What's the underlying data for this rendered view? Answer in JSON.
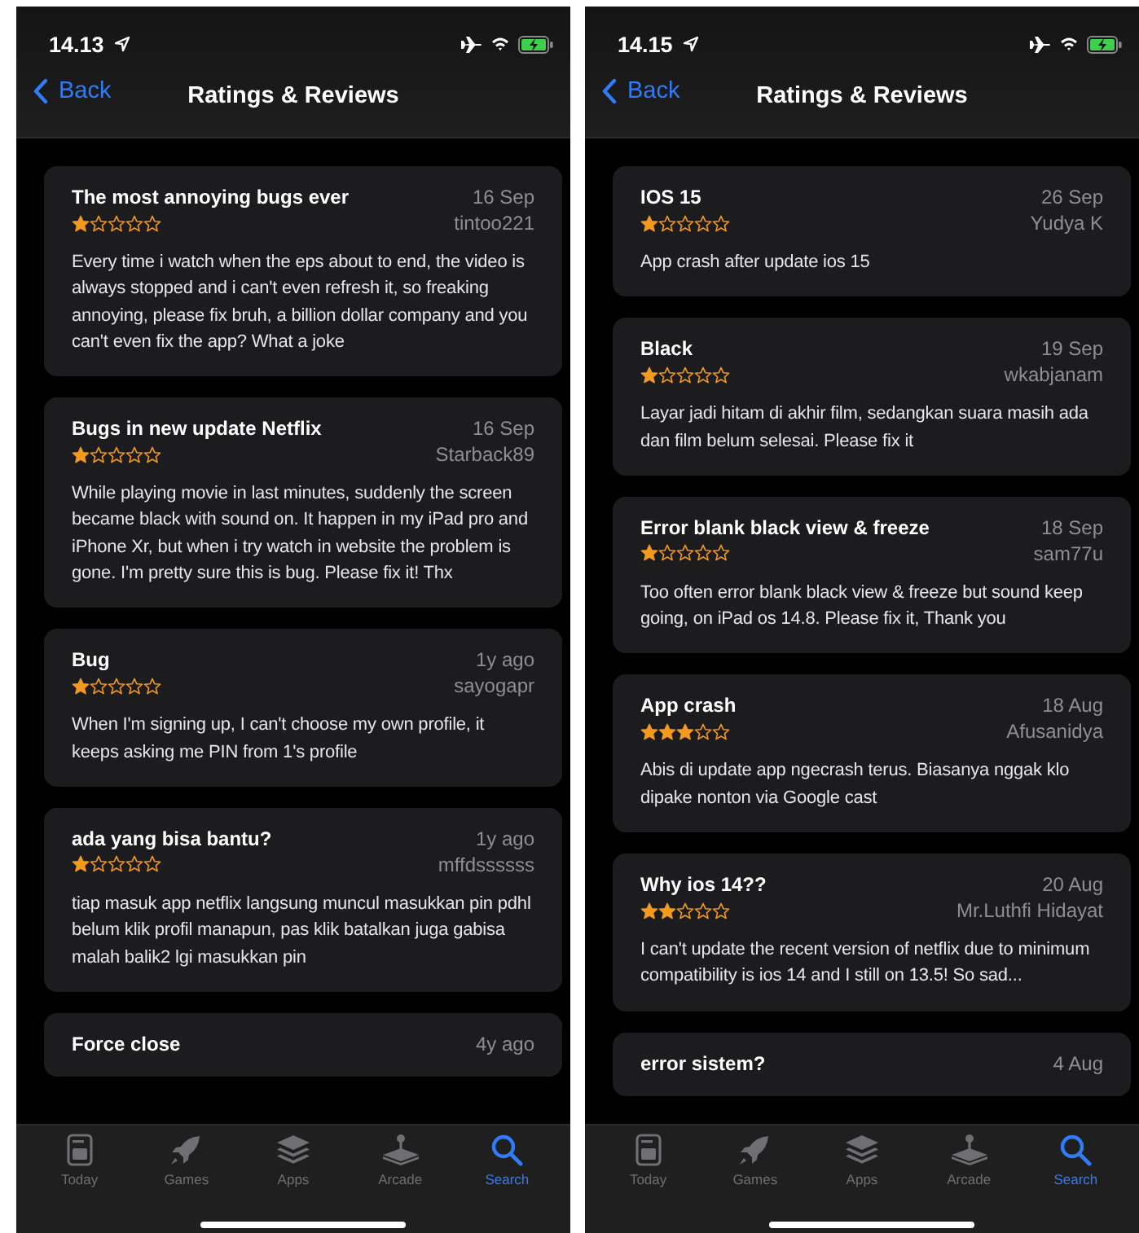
{
  "screens": [
    {
      "status_bar": {
        "time": "14.13"
      },
      "nav": {
        "back": "Back",
        "title": "Ratings & Reviews"
      },
      "reviews": [
        {
          "title": "The most annoying bugs ever",
          "date": "16 Sep",
          "stars": 1,
          "author": "tintoo221",
          "body": "Every time i watch when the eps about to end, the video is always stopped and i can't even refresh it, so freaking annoying, please fix bruh, a billion dollar company and you can't even fix the app? What a joke"
        },
        {
          "title": "Bugs in new update Netflix",
          "date": "16 Sep",
          "stars": 1,
          "author": "Starback89",
          "body": "While playing movie in last minutes, suddenly the screen became black with sound on. It happen in my iPad pro and iPhone Xr, but when i try watch in website the problem is gone. I'm pretty sure this is bug. Please fix it! Thx"
        },
        {
          "title": "Bug",
          "date": "1y ago",
          "stars": 1,
          "author": "sayogapr",
          "body": "When I'm signing up, I can't choose my own profile, it keeps asking me PIN from 1's profile"
        },
        {
          "title": "ada yang bisa bantu?",
          "date": "1y ago",
          "stars": 1,
          "author": "mffdssssss",
          "body": "tiap masuk app netflix langsung muncul masukkan pin pdhl belum klik profil manapun, pas klik batalkan juga gabisa malah balik2 lgi masukkan pin"
        },
        {
          "title": "Force close",
          "date": "4y ago"
        }
      ],
      "tabs": [
        {
          "label": "Today",
          "kind": "today",
          "selected": false
        },
        {
          "label": "Games",
          "kind": "games",
          "selected": false
        },
        {
          "label": "Apps",
          "kind": "apps",
          "selected": false
        },
        {
          "label": "Arcade",
          "kind": "arcade",
          "selected": false
        },
        {
          "label": "Search",
          "kind": "search",
          "selected": true
        }
      ]
    },
    {
      "status_bar": {
        "time": "14.15"
      },
      "nav": {
        "back": "Back",
        "title": "Ratings & Reviews"
      },
      "reviews": [
        {
          "title": "IOS 15",
          "date": "26 Sep",
          "stars": 1,
          "author": "Yudya K",
          "body": "App crash after update ios 15"
        },
        {
          "title": "Black",
          "date": "19 Sep",
          "stars": 1,
          "author": "wkabjanam",
          "body": "Layar jadi hitam di akhir film, sedangkan suara masih ada dan film belum selesai. Please fix it"
        },
        {
          "title": "Error blank black view & freeze",
          "date": "18 Sep",
          "stars": 1,
          "author": "sam77u",
          "body": "Too often error blank black view & freeze but sound keep going, on iPad os 14.8. Please fix it, Thank you"
        },
        {
          "title": "App crash",
          "date": "18 Aug",
          "stars": 3,
          "author": "Afusanidya",
          "body": "Abis di update app ngecrash terus. Biasanya nggak klo dipake nonton via Google cast"
        },
        {
          "title": "Why ios 14??",
          "date": "20 Aug",
          "stars": 2,
          "author": "Mr.Luthfi Hidayat",
          "body": "I can't update the recent version of netflix due to minimum compatibility is ios 14 and I still on 13.5! So sad..."
        },
        {
          "title": "error sistem?",
          "date": "4 Aug"
        }
      ],
      "tabs": [
        {
          "label": "Today",
          "kind": "today",
          "selected": false
        },
        {
          "label": "Games",
          "kind": "games",
          "selected": false
        },
        {
          "label": "Apps",
          "kind": "apps",
          "selected": false
        },
        {
          "label": "Arcade",
          "kind": "arcade",
          "selected": false
        },
        {
          "label": "Search",
          "kind": "search",
          "selected": true
        }
      ]
    }
  ]
}
